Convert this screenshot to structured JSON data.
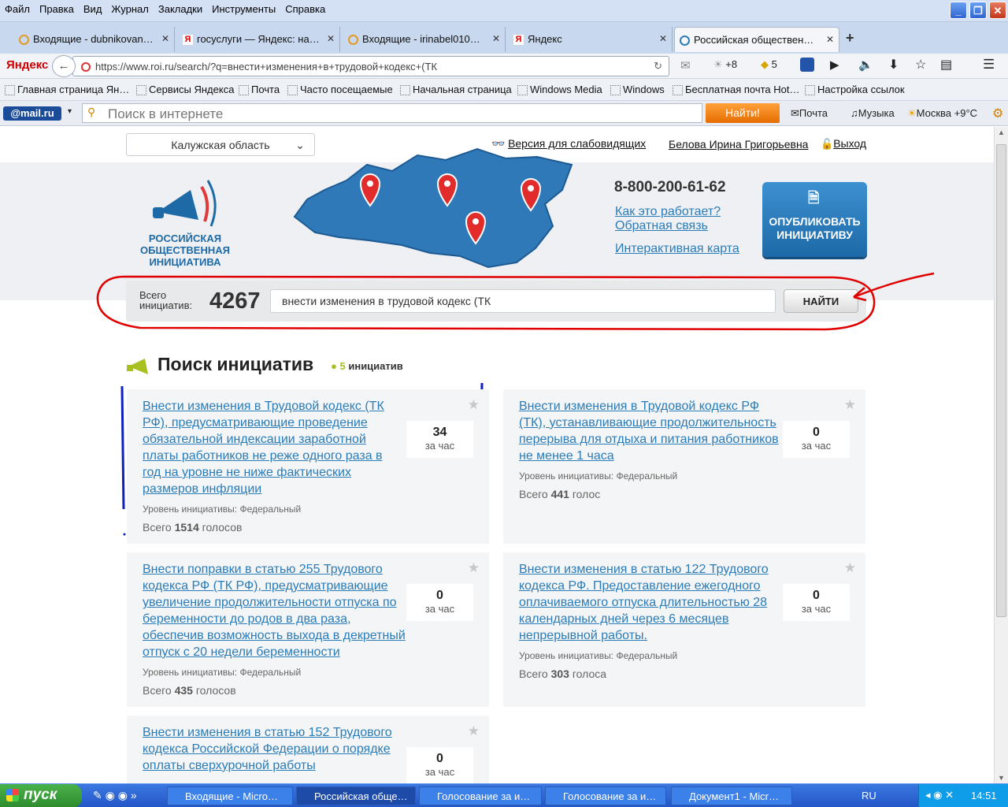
{
  "menu": [
    "Файл",
    "Правка",
    "Вид",
    "Журнал",
    "Закладки",
    "Инструменты",
    "Справка"
  ],
  "tabs": [
    {
      "label": "Входящие - dubnikovan…",
      "icon": "mail-icon"
    },
    {
      "label": "госуслуги — Яндекс: на…",
      "icon": "yandex-icon"
    },
    {
      "label": "Входящие - irinabel010…",
      "icon": "mail-icon"
    },
    {
      "label": "Яндекс",
      "icon": "yandex-icon"
    },
    {
      "label": "Российская обществен…",
      "icon": "roi-icon"
    }
  ],
  "nav": {
    "brand": "Яндекс",
    "url": "https://www.roi.ru/search/?q=внести+изменения+в+трудовой+кодекс+(ТК",
    "weather": "+8",
    "count": "5"
  },
  "bookmarks": [
    "Главная страница Ян…",
    "Сервисы Яндекса",
    "Почта",
    "Часто посещаемые",
    "Начальная страница",
    "Windows Media",
    "Windows",
    "Бесплатная почта Hot…",
    "Настройка ссылок"
  ],
  "mailbar": {
    "logo": "@mail.ru",
    "placeholder": "Поиск в интернете",
    "find": "Найти!",
    "mail": "Почта",
    "music": "Музыка",
    "weather": "Москва +9°C"
  },
  "site": {
    "region": "Калужская область",
    "accessibility": "Версия для слабовидящих",
    "user": "Белова Ирина Григорьевна",
    "logout": "Выход",
    "logo": [
      "РОССИЙСКАЯ",
      "ОБЩЕСТВЕННАЯ",
      "ИНИЦИАТИВА"
    ],
    "phone": "8-800-200-61-62",
    "how": "Как это работает?",
    "feedback": "Обратная связь",
    "map": "Интерактивная карта",
    "publish": [
      "ОПУБЛИКОВАТЬ",
      "ИНИЦИАТИВУ"
    ]
  },
  "search": {
    "total_label1": "Всего",
    "total_label2": "инициатив:",
    "total": "4267",
    "query": "внести изменения в трудовой кодекс (ТК",
    "button": "НАЙТИ"
  },
  "results": {
    "title": "Поиск инициатив",
    "count": "5",
    "count_label": "инициатив"
  },
  "cards": [
    {
      "title": "Внести изменения в Трудовой кодекс (ТК РФ), предусматривающие проведение обязательной индексации заработной платы работников не реже одного раза в год на уровне не ниже фактических размеров инфляции",
      "votes": "34",
      "per": "за час",
      "level": "Уровень инициативы: Федеральный",
      "total_pre": "Всего",
      "total": "1514",
      "total_post": "голосов"
    },
    {
      "title": "Внести изменения в Трудовой кодекс РФ (ТК), устанавливающие продолжительность перерыва для отдыха и питания работников не менее 1 часа",
      "votes": "0",
      "per": "за час",
      "level": "Уровень инициативы: Федеральный",
      "total_pre": "Всего",
      "total": "441",
      "total_post": "голос"
    },
    {
      "title": "Внести поправки в статью 255 Трудового кодекса РФ (ТК РФ), предусматривающие увеличение продолжительности отпуска по беременности до родов в два раза, обеспечив возможность выхода в декретный отпуск с 20 недели беременности",
      "votes": "0",
      "per": "за час",
      "level": "Уровень инициативы: Федеральный",
      "total_pre": "Всего",
      "total": "435",
      "total_post": "голосов"
    },
    {
      "title": "Внести изменения в статью 122 Трудового кодекса РФ. Предоставление ежегодного оплачиваемого отпуска длительностью 28 календарных дней через 6 месяцев непрерывной работы.",
      "votes": "0",
      "per": "за час",
      "level": "Уровень инициативы: Федеральный",
      "total_pre": "Всего",
      "total": "303",
      "total_post": "голоса"
    },
    {
      "title": "Внести изменения в статью 152 Трудового кодекса Российской Федерации о порядке оплаты сверхурочной работы",
      "votes": "0",
      "per": "за час"
    }
  ],
  "taskbar": {
    "start": "пуск",
    "items": [
      "Входящие - Micro…",
      "Российская обще…",
      "Голосование за и…",
      "Голосование за и…",
      "Документ1 - Micr…"
    ],
    "lang": "RU",
    "time": "14:51"
  },
  "colors": {
    "link": "#2a7cb8",
    "publish": "#1d69a8",
    "mail_find": "#f07c0c",
    "annotation_red": "#e00000",
    "annotation_blue": "#1020c0"
  }
}
